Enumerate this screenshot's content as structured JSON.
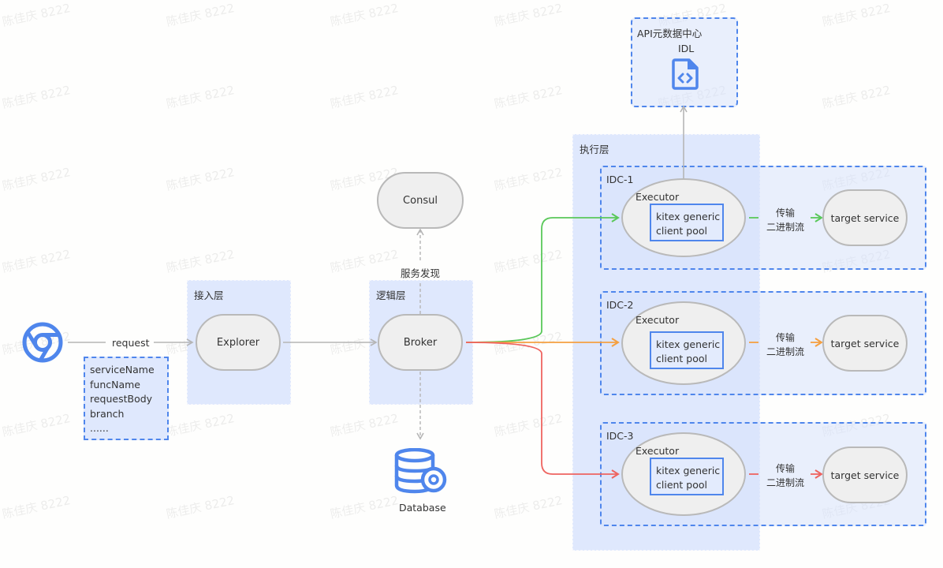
{
  "watermark": "陈佳庆 8222",
  "colors": {
    "accent_blue": "#4f86ec",
    "layer_bg": "#dfe8fd",
    "node_fill": "#efefef",
    "node_border": "#b9b9b9",
    "arrow_gray": "#b5b5b5",
    "route_green": "#5ac85a",
    "route_orange": "#f5a040",
    "route_red": "#ee6460"
  },
  "client": {
    "icon": "chrome-browser-icon",
    "request_label": "request",
    "params": [
      "serviceName",
      "funcName",
      "requestBody",
      "branch",
      "......"
    ]
  },
  "access_layer": {
    "label": "接入层",
    "node": "Explorer"
  },
  "logic_layer": {
    "label": "逻辑层",
    "node": "Broker"
  },
  "consul": {
    "node": "Consul",
    "edge_label": "服务发现"
  },
  "database": {
    "icon": "database-gear-icon",
    "label": "Database"
  },
  "api_center": {
    "label": "API元数据中心",
    "item": "IDL",
    "icon": "code-file-icon"
  },
  "exec_layer": {
    "label": "执行层",
    "idcs": [
      {
        "label": "IDC-1",
        "executor": "Executor",
        "pool": "kitex generic client pool",
        "transfer": [
          "传输",
          "二进制流"
        ],
        "target": "target service",
        "route_color": "green"
      },
      {
        "label": "IDC-2",
        "executor": "Executor",
        "pool": "kitex generic client pool",
        "transfer": [
          "传输",
          "二进制流"
        ],
        "target": "target service",
        "route_color": "orange"
      },
      {
        "label": "IDC-3",
        "executor": "Executor",
        "pool": "kitex generic client pool",
        "transfer": [
          "传输",
          "二进制流"
        ],
        "target": "target service",
        "route_color": "red"
      }
    ]
  }
}
